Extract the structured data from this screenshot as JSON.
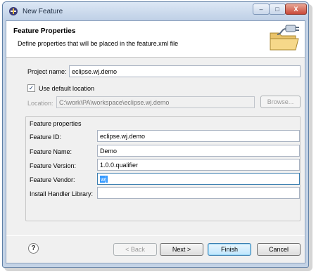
{
  "window": {
    "title": "New Feature"
  },
  "titlebar_buttons": {
    "minimize": "–",
    "maximize": "□",
    "close": "X"
  },
  "banner": {
    "title": "Feature Properties",
    "description": "Define properties that will be placed in the feature.xml file"
  },
  "project": {
    "name_label": "Project name:",
    "name_value": "eclipse.wj.demo",
    "use_default_label": "Use default location",
    "use_default_checked": true,
    "checkmark": "✓",
    "location_label": "Location:",
    "location_value": "C:\\work\\PA\\workspace\\eclipse.wj.demo",
    "browse_label": "Browse..."
  },
  "feature_properties": {
    "group_label": "Feature properties",
    "id_label": "Feature ID:",
    "id_value": "eclipse.wj.demo",
    "name_label": "Feature Name:",
    "name_value": "Demo",
    "version_label": "Feature Version:",
    "version_value": "1.0.0.qualifier",
    "vendor_label": "Feature Vendor:",
    "vendor_value": "wj",
    "install_handler_label": "Install Handler Library:",
    "install_handler_value": ""
  },
  "footer": {
    "help_icon": "?",
    "back_label": "< Back",
    "next_label": "Next >",
    "finish_label": "Finish",
    "cancel_label": "Cancel"
  },
  "icons": {
    "app": "eclipse-plugin-icon",
    "banner": "feature-folder-plug-icon",
    "dropdown": "chevron-down-icon"
  }
}
